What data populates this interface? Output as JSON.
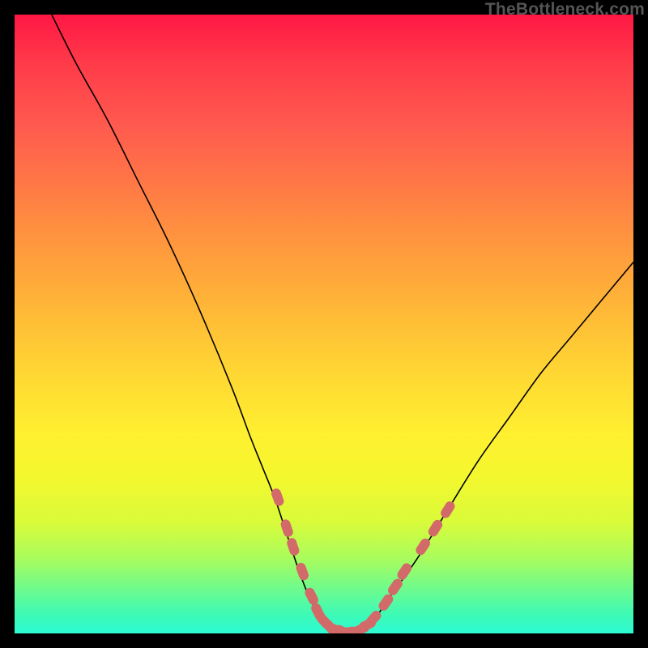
{
  "watermark": "TheBottleneck.com",
  "chart_data": {
    "type": "line",
    "title": "",
    "xlabel": "",
    "ylabel": "",
    "xlim": [
      0,
      100
    ],
    "ylim": [
      0,
      100
    ],
    "grid": false,
    "legend": false,
    "series": [
      {
        "name": "curve",
        "x": [
          6,
          10,
          15,
          20,
          25,
          30,
          35,
          38,
          40,
          42,
          44,
          46,
          48,
          50,
          52,
          54,
          56,
          58,
          60,
          65,
          70,
          75,
          80,
          85,
          90,
          95,
          100
        ],
        "y": [
          100,
          92,
          83,
          73,
          63,
          52,
          40,
          32,
          27,
          22,
          16,
          10,
          5,
          2,
          0.5,
          0,
          0.5,
          2,
          5,
          12,
          20,
          28,
          35,
          42,
          48,
          54,
          60
        ]
      }
    ],
    "markers": [
      {
        "x": 42.5,
        "y": 22
      },
      {
        "x": 44,
        "y": 17
      },
      {
        "x": 45,
        "y": 14
      },
      {
        "x": 46.5,
        "y": 10
      },
      {
        "x": 48,
        "y": 6
      },
      {
        "x": 49,
        "y": 3.5
      },
      {
        "x": 50,
        "y": 2
      },
      {
        "x": 51,
        "y": 1
      },
      {
        "x": 52,
        "y": 0.5
      },
      {
        "x": 53,
        "y": 0.3
      },
      {
        "x": 54,
        "y": 0.2
      },
      {
        "x": 55,
        "y": 0.3
      },
      {
        "x": 56,
        "y": 0.7
      },
      {
        "x": 57,
        "y": 1.4
      },
      {
        "x": 58,
        "y": 2.4
      },
      {
        "x": 60,
        "y": 5
      },
      {
        "x": 61.5,
        "y": 7.5
      },
      {
        "x": 63,
        "y": 10
      },
      {
        "x": 66,
        "y": 14
      },
      {
        "x": 68,
        "y": 17
      },
      {
        "x": 70,
        "y": 20
      }
    ],
    "background_gradient": {
      "top": "#ff1744",
      "mid": "#ffd733",
      "bottom": "#2dfbd4"
    }
  }
}
